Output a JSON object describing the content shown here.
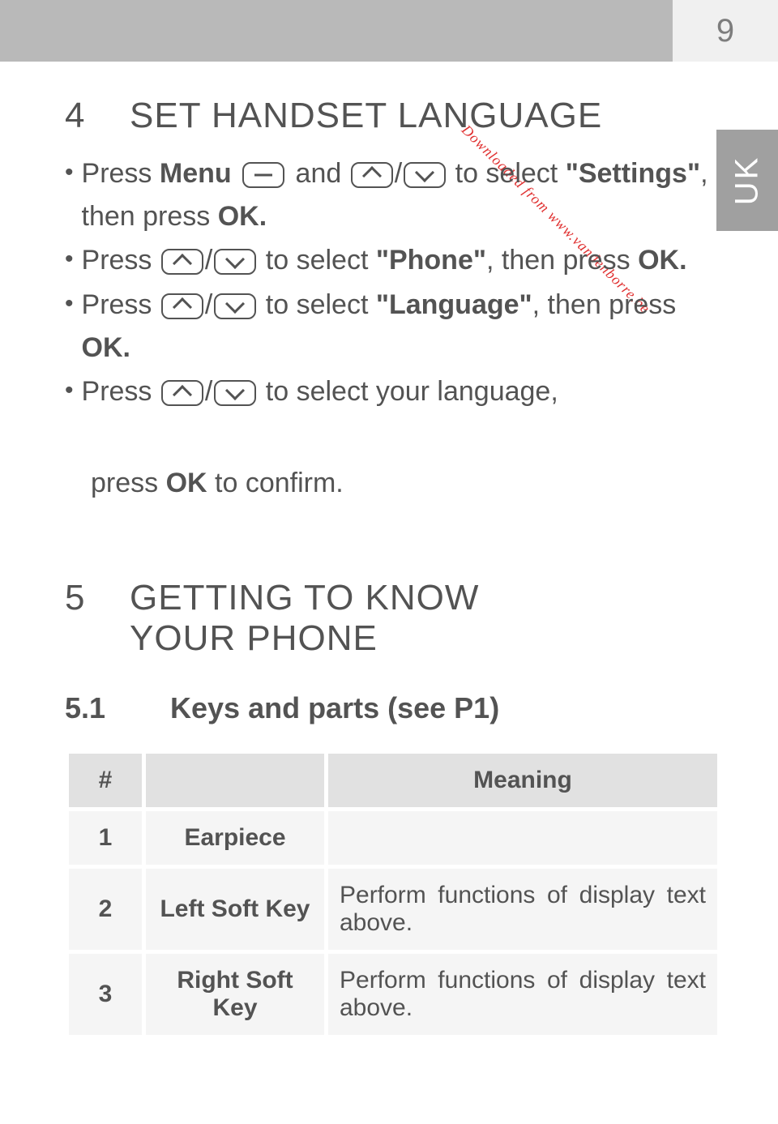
{
  "page_number": "9",
  "side_tab": "UK",
  "watermark": "Downloaded from www.vandenborre.be",
  "section4": {
    "num": "4",
    "title": "SET HANDSET LANGUAGE",
    "bullets": {
      "b1_pre": "Press ",
      "b1_menu": "Menu",
      "b1_mid": " and ",
      "b1_tosel": " to select ",
      "b1_settings": "\"Settings\"",
      "b1_post": ", then press ",
      "b1_ok": "OK.",
      "b2_pre": "Press ",
      "b2_tosel": " to select ",
      "b2_phone": "\"Phone\"",
      "b2_post": ", then press ",
      "b2_ok": "OK.",
      "b3_pre": "Press ",
      "b3_tosel": " to select ",
      "b3_lang": "\"Language\"",
      "b3_post": ", then press ",
      "b3_ok": "OK.",
      "b4_pre": "Press ",
      "b4_tosel": " to select your language,",
      "b4_extra_pre": "press ",
      "b4_ok": "OK",
      "b4_extra_post": " to confirm."
    }
  },
  "section5": {
    "num": "5",
    "title_l1": "GETTING TO KNOW",
    "title_l2": "YOUR PHONE",
    "sub_num": "5.1",
    "sub_title": "Keys and parts (see P1)",
    "table": {
      "h1": "#",
      "h2": "",
      "h3": "Meaning",
      "rows": [
        {
          "num": "1",
          "name": "Earpiece",
          "meaning": ""
        },
        {
          "num": "2",
          "name": "Left Soft Key",
          "meaning": "Perform functions of display text above."
        },
        {
          "num": "3",
          "name": "Right Soft Key",
          "meaning": "Perform functions of display text above."
        }
      ]
    }
  }
}
